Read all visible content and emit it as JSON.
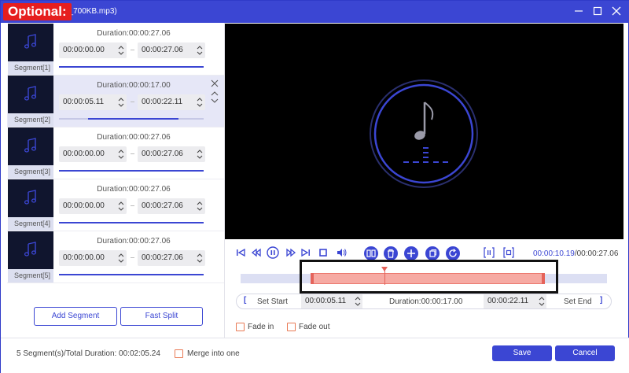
{
  "window": {
    "title": "MP3_700KB.mp3)",
    "badge": "Optional:"
  },
  "segments": [
    {
      "label": "Segment[1]",
      "duration": "Duration:00:00:27.06",
      "start": "00:00:00.00",
      "end": "00:00:27.06",
      "active": false
    },
    {
      "label": "Segment[2]",
      "duration": "Duration:00:00:17.00",
      "start": "00:00:05.11",
      "end": "00:00:22.11",
      "active": true
    },
    {
      "label": "Segment[3]",
      "duration": "Duration:00:00:27.06",
      "start": "00:00:00.00",
      "end": "00:00:27.06",
      "active": false
    },
    {
      "label": "Segment[4]",
      "duration": "Duration:00:00:27.06",
      "start": "00:00:00.00",
      "end": "00:00:27.06",
      "active": false
    },
    {
      "label": "Segment[5]",
      "duration": "Duration:00:00:27.06",
      "start": "00:00:00.00",
      "end": "00:00:27.06",
      "active": false
    }
  ],
  "buttons": {
    "add_segment": "Add Segment",
    "fast_split": "Fast Split",
    "save": "Save",
    "cancel": "Cancel"
  },
  "player": {
    "current_time": "00:00:10.19",
    "total_time": "/00:00:27.06"
  },
  "setbar": {
    "set_start": "Set Start",
    "start_value": "00:00:05.11",
    "duration": "Duration:00:00:17.00",
    "end_value": "00:00:22.11",
    "set_end": "Set End",
    "left_bracket": "[",
    "right_bracket": "]"
  },
  "options": {
    "fade_in": "Fade in",
    "fade_out": "Fade out",
    "merge": "Merge into one"
  },
  "footer": {
    "summary": "5 Segment(s)/Total Duration: 00:02:05.24"
  },
  "colors": {
    "accent": "#3b46d3",
    "selection": "#f6aaa3",
    "playhead": "#e5635a",
    "badge": "#e61e1e"
  }
}
